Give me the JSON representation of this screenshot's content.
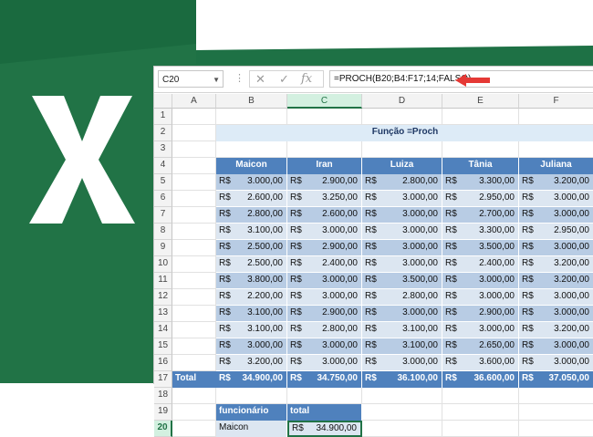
{
  "name_box": "C20",
  "formula": "=PROCH(B20;B4:F17;14;FALSO)",
  "icons": {
    "cancel": "x-icon",
    "enter": "check-icon",
    "function": "fx-icon"
  },
  "columns": [
    "A",
    "B",
    "C",
    "D",
    "E",
    "F"
  ],
  "rows": [
    "1",
    "2",
    "3",
    "4",
    "5",
    "6",
    "7",
    "8",
    "9",
    "10",
    "11",
    "12",
    "13",
    "14",
    "15",
    "16",
    "17",
    "18",
    "19",
    "20"
  ],
  "title": "Função =Proch",
  "currency": "R$",
  "names": [
    "Maicon",
    "Iran",
    "Luiza",
    "Tânia",
    "Juliana"
  ],
  "data": [
    [
      "3.000,00",
      "2.900,00",
      "2.800,00",
      "3.300,00",
      "3.200,00"
    ],
    [
      "2.600,00",
      "3.250,00",
      "3.000,00",
      "2.950,00",
      "3.000,00"
    ],
    [
      "2.800,00",
      "2.600,00",
      "3.000,00",
      "2.700,00",
      "3.000,00"
    ],
    [
      "3.100,00",
      "3.000,00",
      "3.000,00",
      "3.300,00",
      "2.950,00"
    ],
    [
      "2.500,00",
      "2.900,00",
      "3.000,00",
      "3.500,00",
      "3.000,00"
    ],
    [
      "2.500,00",
      "2.400,00",
      "3.000,00",
      "2.400,00",
      "3.200,00"
    ],
    [
      "3.800,00",
      "3.000,00",
      "3.500,00",
      "3.000,00",
      "3.200,00"
    ],
    [
      "2.200,00",
      "3.000,00",
      "2.800,00",
      "3.000,00",
      "3.000,00"
    ],
    [
      "3.100,00",
      "2.900,00",
      "3.000,00",
      "2.900,00",
      "3.000,00"
    ],
    [
      "3.100,00",
      "2.800,00",
      "3.100,00",
      "3.000,00",
      "3.200,00"
    ],
    [
      "3.000,00",
      "3.000,00",
      "3.100,00",
      "2.650,00",
      "3.000,00"
    ],
    [
      "3.200,00",
      "3.000,00",
      "3.000,00",
      "3.600,00",
      "3.000,00"
    ]
  ],
  "total_label": "Total",
  "totals": [
    "34.900,00",
    "34.750,00",
    "36.100,00",
    "36.600,00",
    "37.050,00"
  ],
  "result": {
    "hdr_name": "funcionário",
    "hdr_total": "total",
    "name": "Maicon",
    "total": "34.900,00"
  },
  "colors": {
    "excel_green": "#217346",
    "header_blue": "#4f81bd",
    "band_light": "#dce6f1",
    "band_dark": "#b8cce4",
    "title_bg": "#ddebf7",
    "arrow": "#e53935"
  }
}
